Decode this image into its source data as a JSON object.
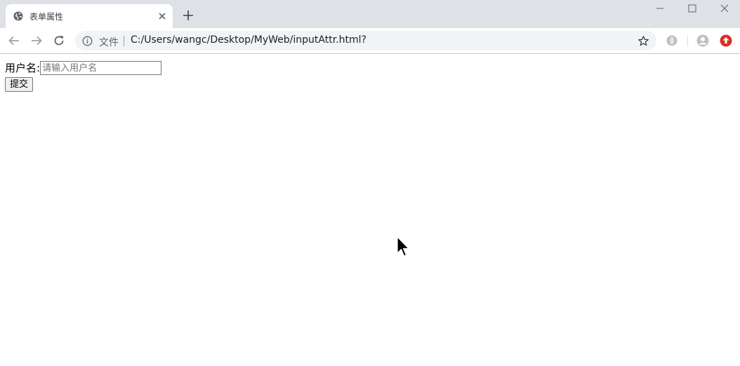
{
  "tab": {
    "title": "表单属性"
  },
  "toolbar": {
    "security_label": "文件",
    "url": "C:/Users/wangc/Desktop/MyWeb/inputAttr.html?"
  },
  "form": {
    "username_label": "用户名:",
    "username_placeholder": "请输入用户名",
    "username_value": "",
    "submit_label": "提交"
  },
  "icons": {
    "favicon": "globe-icon",
    "tab_close": "close-icon",
    "new_tab": "plus-icon",
    "back": "arrow-left-icon",
    "forward": "arrow-right-icon",
    "reload": "reload-icon",
    "info": "info-icon",
    "bookmark": "star-icon",
    "profile": "avatar-icon",
    "extension_red": "upload-icon"
  },
  "colors": {
    "tabstrip_bg": "#dee1e6",
    "omnibox_bg": "#f1f3f4",
    "extension_red": "#d93025"
  }
}
